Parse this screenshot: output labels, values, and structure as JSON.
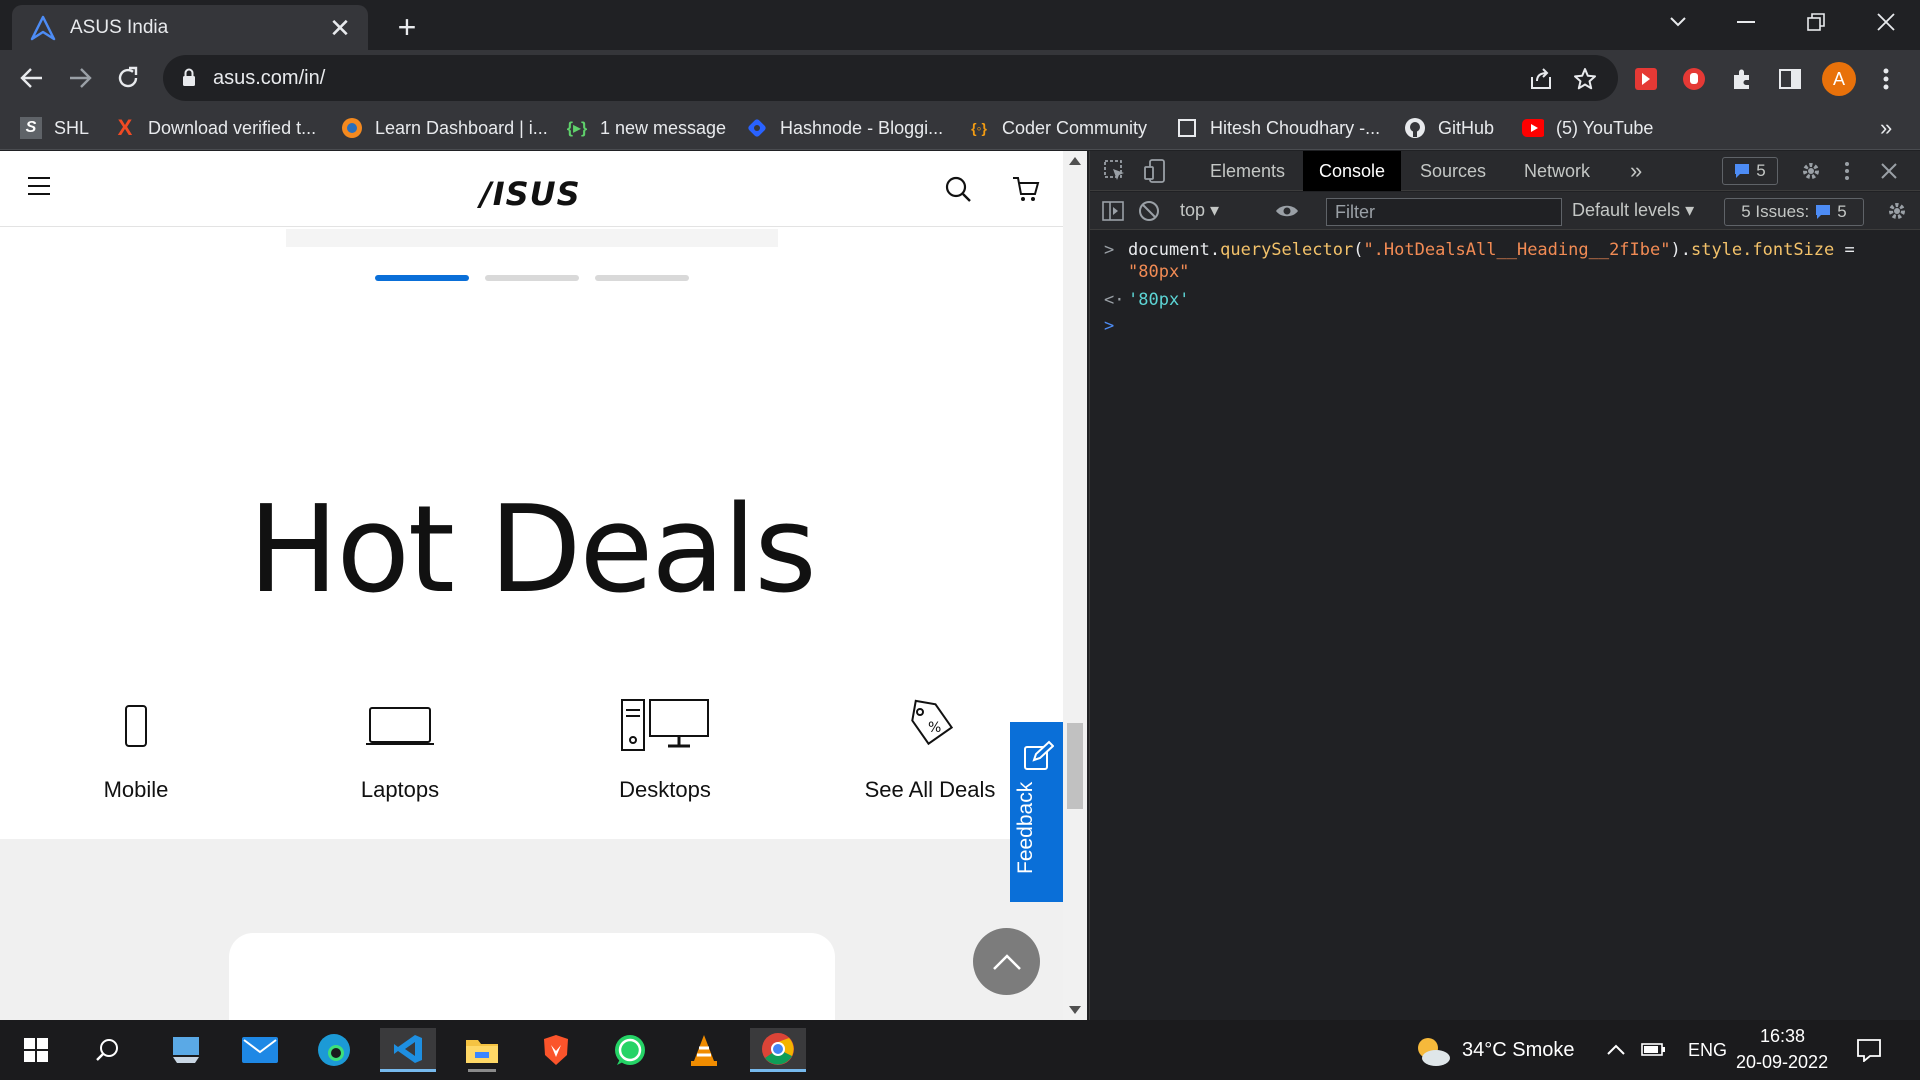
{
  "browser": {
    "tab_title": "ASUS India",
    "tab_close": "✕",
    "new_tab": "+",
    "url": "asus.com/in/",
    "profile_initial": "A",
    "bookmarks": [
      {
        "label": "SHL",
        "icon": "shl-icon"
      },
      {
        "label": "Download verified t...",
        "icon": "x-brand-icon"
      },
      {
        "label": "Learn Dashboard | i...",
        "icon": "orange-circle-icon"
      },
      {
        "label": "1 new message",
        "icon": "message-icon"
      },
      {
        "label": "Hashnode - Bloggi...",
        "icon": "hashnode-icon"
      },
      {
        "label": "Coder Community",
        "icon": "code-braces-icon"
      },
      {
        "label": "Hitesh Choudhary -...",
        "icon": "square-icon"
      },
      {
        "label": "GitHub",
        "icon": "github-icon"
      },
      {
        "label": "(5) YouTube",
        "icon": "youtube-icon"
      }
    ],
    "bookmarks_more": "»"
  },
  "site": {
    "logo": "/ISUS",
    "heading": "Hot Deals",
    "categories": [
      {
        "label": "Mobile",
        "icon": "mobile-icon"
      },
      {
        "label": "Laptops",
        "icon": "laptop-icon"
      },
      {
        "label": "Desktops",
        "icon": "desktop-icon"
      },
      {
        "label": "See All Deals",
        "icon": "deal-tag-icon"
      }
    ],
    "feedback": "Feedback",
    "carousel_active_dot": 1,
    "colors": {
      "accent": "#0a6fd8",
      "dot_inactive": "#d9d9d9",
      "dot_active": "#0a6fd8"
    }
  },
  "devtools": {
    "tabs": [
      "Elements",
      "Console",
      "Sources",
      "Network"
    ],
    "active_tab": "Console",
    "more_tabs": "»",
    "messages_badge": "5",
    "context": "top",
    "filter_placeholder": "Filter",
    "levels": "Default levels",
    "issues_label": "5 Issues:",
    "issues_count": "5",
    "console_lines": [
      {
        "prompt": ">",
        "text": "document.querySelector(\".HotDealsAll__Heading__2fIbe\").style.fontSize =\n\"80px\""
      },
      {
        "prompt": "<·",
        "text": "'80px'"
      },
      {
        "prompt": ">",
        "text": ""
      }
    ]
  },
  "taskbar": {
    "weather": "34°C  Smoke",
    "language": "ENG",
    "time": "16:38",
    "date": "20-09-2022"
  }
}
